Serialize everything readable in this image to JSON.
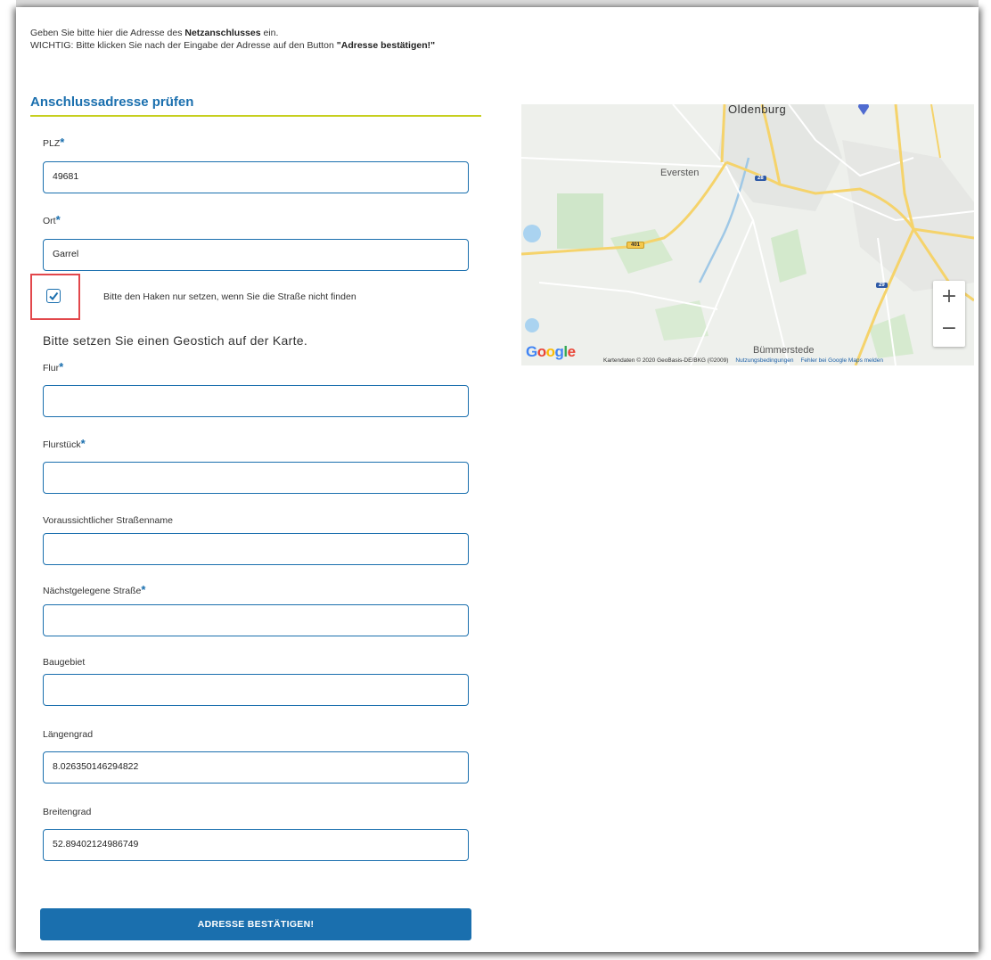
{
  "intro": {
    "line1_pre": "Geben Sie bitte hier die Adresse des ",
    "line1_bold": "Netzanschlusses",
    "line1_post": " ein.",
    "line2_pre": "WICHTIG: Bitte klicken Sie nach der Eingabe der Adresse auf den Button ",
    "line2_bold": "\"Adresse bestätigen!\""
  },
  "section_title": "Anschlussadresse prüfen",
  "required_marker": "*",
  "fields": {
    "plz": {
      "label": "PLZ",
      "value": "49681"
    },
    "ort": {
      "label": "Ort",
      "value": "Garrel"
    },
    "flur": {
      "label": "Flur",
      "value": ""
    },
    "flurstueck": {
      "label": "Flurstück",
      "value": ""
    },
    "strassenname": {
      "label": "Voraussichtlicher Straßenname",
      "value": ""
    },
    "naechste_strasse": {
      "label": "Nächstgelegene Straße",
      "value": ""
    },
    "baugebiet": {
      "label": "Baugebiet",
      "value": ""
    },
    "laengengrad": {
      "label": "Längengrad",
      "value": "8.026350146294822"
    },
    "breitengrad": {
      "label": "Breitengrad",
      "value": "52.89402124986749"
    }
  },
  "checkbox": {
    "label": "Bitte den Haken nur setzen, wenn Sie die Straße nicht finden",
    "checked": true
  },
  "geo_note": "Bitte setzen Sie einen Geostich auf der Karte.",
  "submit_label": "ADRESSE BESTÄTIGEN!",
  "map": {
    "places": {
      "oldenburg": "Oldenburg",
      "eversten": "Eversten",
      "buemmerstede": "Bümmerstede"
    },
    "shields": {
      "a28": "28",
      "a29": "29",
      "b401": "401"
    },
    "zoom_in": "+",
    "zoom_out": "−",
    "logo": "Google",
    "credits": "Kartendaten © 2020 GeoBasis-DE/BKG (©2009)",
    "terms_link": "Nutzungsbedingungen",
    "report_link": "Fehler bei Google Maps melden"
  },
  "colors": {
    "accent": "#1a6fae",
    "underline": "#c7cf1f",
    "highlight": "#e2474b"
  }
}
